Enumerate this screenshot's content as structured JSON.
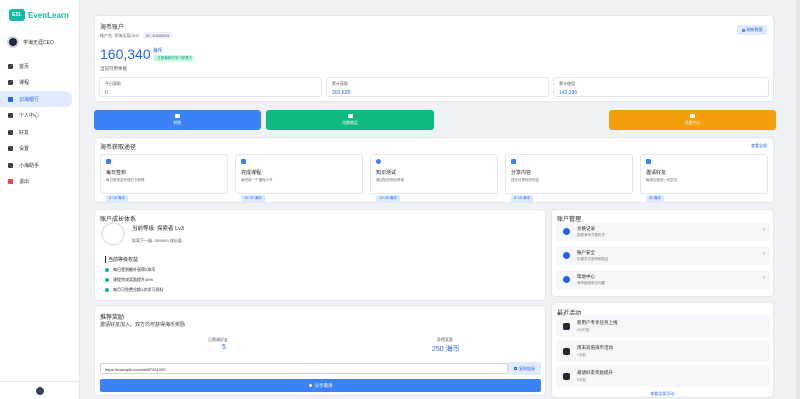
{
  "sidebar": {
    "logo_mark": "ESL",
    "logo_text": "EvenLearn",
    "username": "学海无涯CEO",
    "nav": [
      {
        "label": "首页",
        "icon": "home-icon"
      },
      {
        "label": "课程",
        "icon": "book-icon"
      },
      {
        "label": "识海银行",
        "icon": "bank-icon"
      },
      {
        "label": "个人中心",
        "icon": "user-icon"
      },
      {
        "label": "好友",
        "icon": "friends-icon"
      },
      {
        "label": "设置",
        "icon": "gear-icon"
      },
      {
        "label": "小海助手",
        "icon": "robot-icon"
      },
      {
        "label": "退出",
        "icon": "logout-icon"
      }
    ],
    "active_index": 2
  },
  "account": {
    "title": "海币账户",
    "owner_label": "账户名: 学海无涯CEO",
    "id_label": "ID: 10000001",
    "balance": "160,340",
    "unit": "海币",
    "growth_tag": "↑ 这是最新的学习积累力",
    "balance_label": "当前可用余额",
    "refresh_button": "刷新数据",
    "stats": [
      {
        "label": "今日获取",
        "value": "0"
      },
      {
        "label": "累计获取",
        "value": "303,628"
      },
      {
        "label": "累计使用",
        "value": "142,336"
      }
    ]
  },
  "actions": [
    {
      "label": "转账",
      "color": "#3b82f6"
    },
    {
      "label": "兑换商品",
      "color": "#10b981"
    },
    {
      "label": "兑换中心",
      "color": "#f59e0b"
    }
  ],
  "earn": {
    "title": "海币获取途径",
    "view_all": "查看全部",
    "ways": [
      {
        "title": "每日签到",
        "desc": "每日登录并完成打卡获得",
        "badge": "5~10 海币"
      },
      {
        "title": "完成课程",
        "desc": "每完成一个课程小节",
        "badge": "10~30 海币"
      },
      {
        "title": "知识测试",
        "desc": "通过知识测试考核",
        "badge": "15~30 海币"
      },
      {
        "title": "分享内容",
        "desc": "成功分享知识内容",
        "badge": "8~15 海币"
      },
      {
        "title": "邀请好友",
        "desc": "每成功邀请一位好友",
        "badge": "50 海币"
      }
    ]
  },
  "growth": {
    "title": "账户成长体系",
    "level": "当前等级: 探索者 Lv3",
    "next": "距离下一级: 350/500 成长值",
    "benefits_title": "当前等级权益",
    "benefits": [
      "每日签到额外获得2海币",
      "课程完成奖励提升10%",
      "每月可免费兑换1次学习资料"
    ]
  },
  "invite": {
    "title": "推荐奖励",
    "subtitle": "邀请好友加入，双方均可获得海币奖励",
    "invited_label": "已邀请好友",
    "invited_value": "5",
    "earned_label": "获得奖励",
    "earned_value": "250 海币",
    "link": "https://example.com/ref/87261930",
    "copy_button": "复制链接",
    "share_button": "分享邀请"
  },
  "manage": {
    "title": "账户管理",
    "items": [
      {
        "title": "兑换记录",
        "desc": "查看海币兑换历史"
      },
      {
        "title": "账户安全",
        "desc": "设置支付密码和验证"
      },
      {
        "title": "帮助中心",
        "desc": "海币使用常见问题"
      }
    ]
  },
  "activity": {
    "title": "最近活动",
    "items": [
      {
        "title": "新用户专享任务上线",
        "time": "2小时前"
      },
      {
        "title": "周末双倍海币活动",
        "time": "1天前"
      },
      {
        "title": "邀请好友奖励提升",
        "time": "3天前"
      }
    ],
    "view_all": "查看全部活动 ›"
  }
}
